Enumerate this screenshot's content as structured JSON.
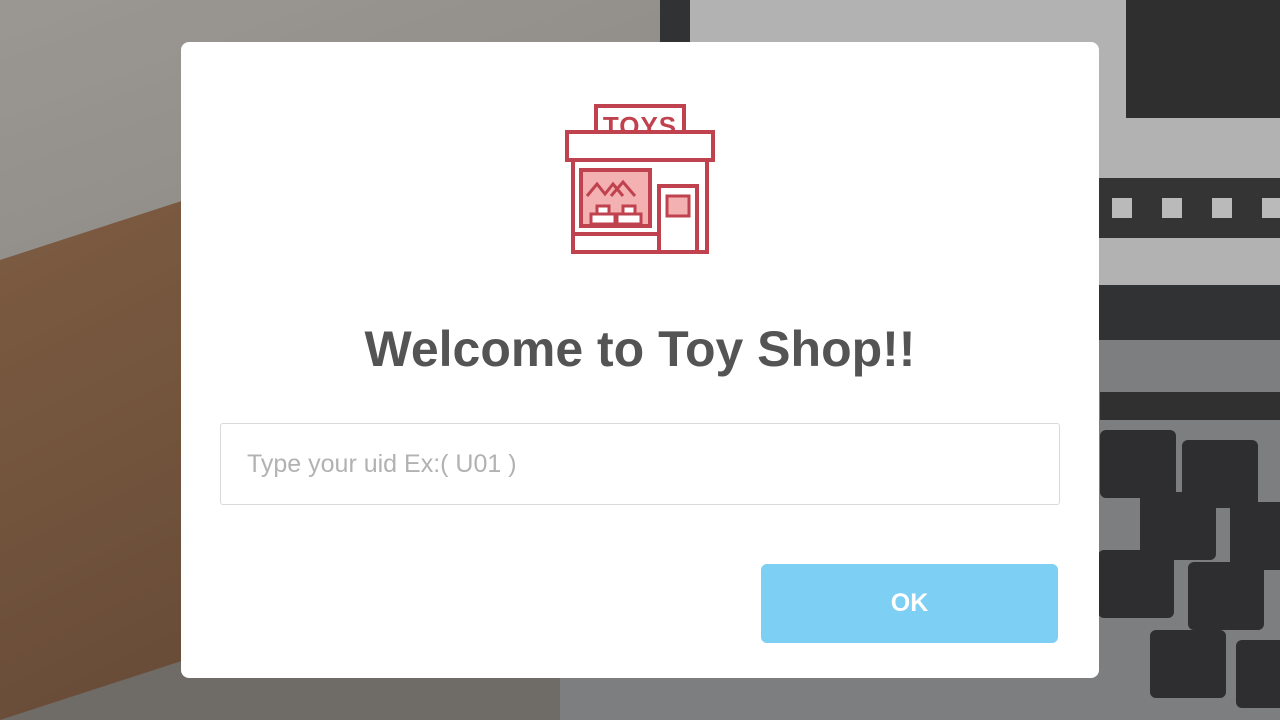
{
  "dialog": {
    "icon": "toy-shop-icon",
    "icon_sign_text": "TOYS",
    "title": "Welcome to Toy Shop!!",
    "uid_input": {
      "value": "",
      "placeholder": "Type your uid Ex:( U01 )"
    },
    "ok_label": "OK"
  },
  "colors": {
    "icon_stroke": "#c0424f",
    "icon_fill": "#f3b1b1",
    "title_text": "#545454",
    "placeholder_text": "#b2b2b2",
    "ok_button_bg": "#7ecff4",
    "ok_button_text": "#ffffff"
  }
}
